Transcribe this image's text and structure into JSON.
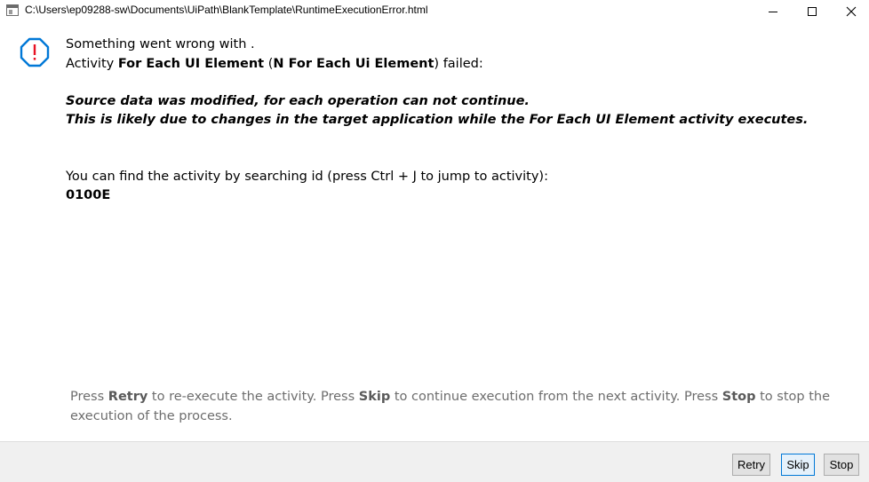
{
  "window": {
    "title": "C:\\Users\\ep09288-sw\\Documents\\UiPath\\BlankTemplate\\RuntimeExecutionError.html"
  },
  "message": {
    "line1": "Something went wrong with .",
    "activity_prefix": "Activity ",
    "activity_name": "For Each UI Element",
    "activity_paren_open": " (",
    "activity_display_name": "N For Each Ui Element",
    "activity_suffix": ") failed:",
    "error_line1": "Source data was modified, for each operation can not continue.",
    "error_line2": "This is likely due to changes in the target application while the For Each UI Element activity executes.",
    "search_hint": "You can find the activity by searching id (press Ctrl + J to jump to activity):",
    "activity_id": "0100E"
  },
  "help": {
    "p1": "Press ",
    "retry_word": "Retry",
    "p2": " to re-execute the activity. Press ",
    "skip_word": "Skip",
    "p3": " to continue execution from the next activity. Press ",
    "stop_word": "Stop",
    "p4": " to stop the execution of the process."
  },
  "buttons": {
    "retry": "Retry",
    "skip": "Skip",
    "stop": "Stop"
  },
  "icons": {
    "error": "error-octagon-icon",
    "accent_color": "#0078d7",
    "error_color": "#e81123"
  }
}
